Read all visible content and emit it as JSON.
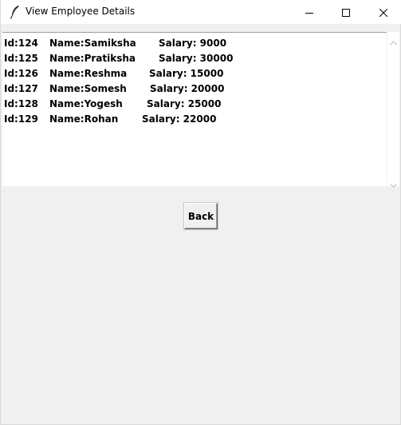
{
  "window": {
    "title": "View Employee Details"
  },
  "records": [
    {
      "id": "Id:124",
      "name": "Name:Samiksha",
      "salary": "Salary: 9000"
    },
    {
      "id": "Id:125",
      "name": "Name:Pratiksha",
      "salary": "Salary: 30000"
    },
    {
      "id": "Id:126",
      "name": "Name:Reshma",
      "salary": "Salary: 15000"
    },
    {
      "id": "Id:127",
      "name": "Name:Somesh",
      "salary": "Salary: 20000"
    },
    {
      "id": "Id:128",
      "name": "Name:Yogesh",
      "salary": "Salary: 25000"
    },
    {
      "id": "Id:129",
      "name": "Name:Rohan",
      "salary": "Salary: 22000"
    }
  ],
  "back_button": {
    "label": "Back"
  },
  "icons": {
    "app": "feather-icon",
    "minimize": "minimize-icon",
    "maximize": "maximize-icon",
    "close": "close-icon",
    "scroll_up": "chevron-up-icon",
    "scroll_down": "chevron-down-icon"
  }
}
